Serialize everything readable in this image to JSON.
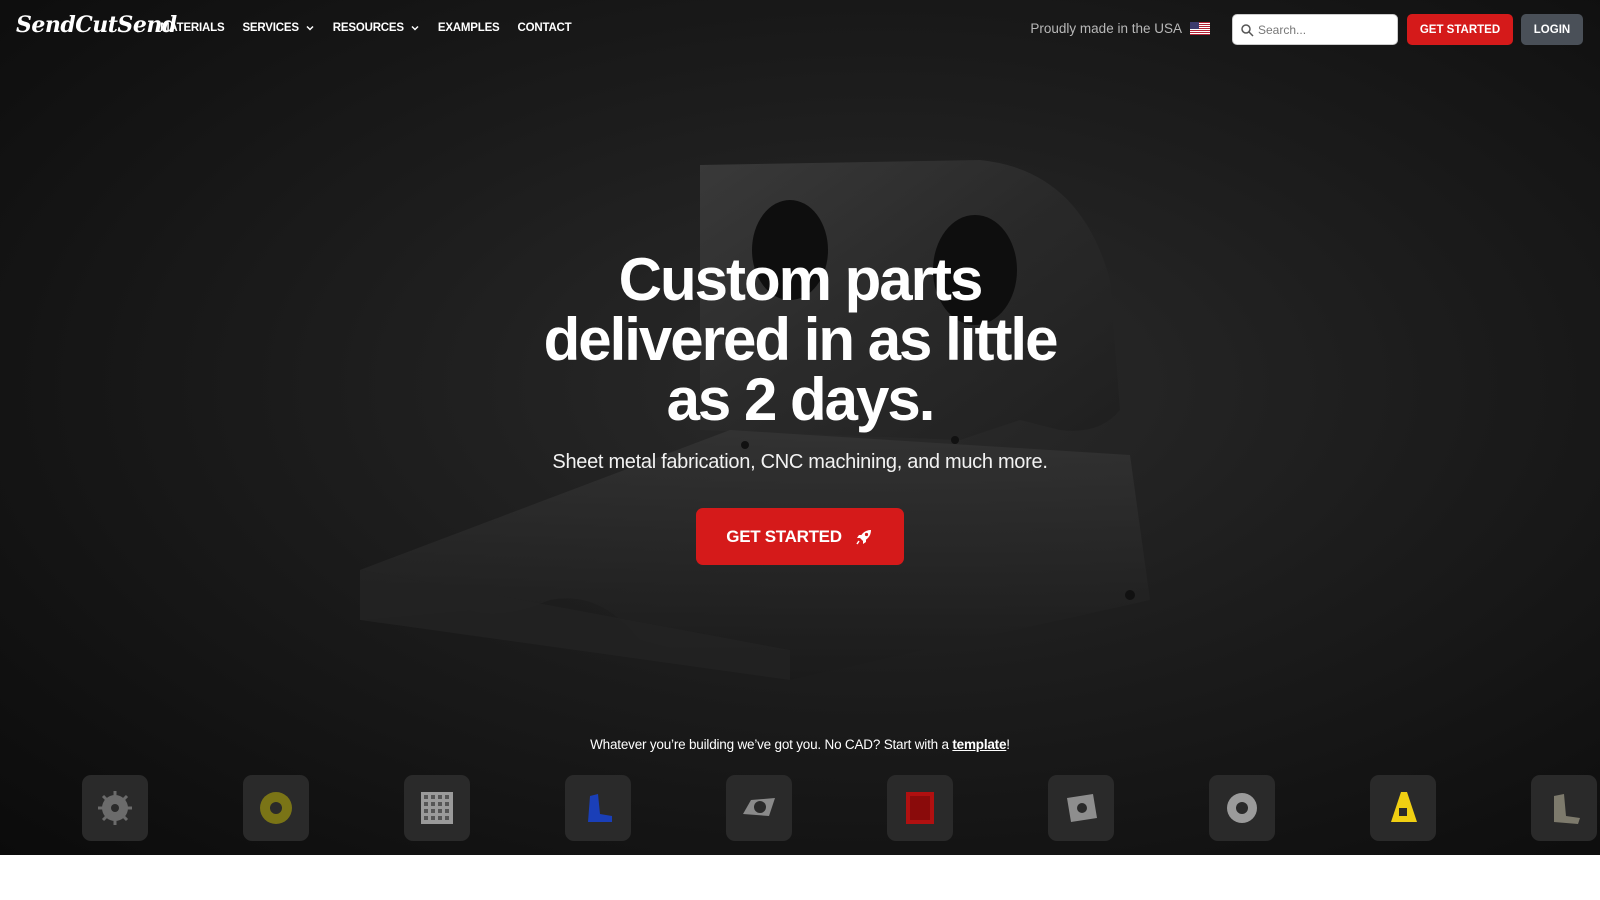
{
  "brand": {
    "logo_text": "SendCutSend"
  },
  "nav": {
    "items": [
      {
        "label": "MATERIALS",
        "has_dropdown": false
      },
      {
        "label": "SERVICES",
        "has_dropdown": true
      },
      {
        "label": "RESOURCES",
        "has_dropdown": true
      },
      {
        "label": "EXAMPLES",
        "has_dropdown": false
      },
      {
        "label": "CONTACT",
        "has_dropdown": false
      }
    ],
    "made_in": "Proudly made in the USA",
    "flag_icon": "us-flag-icon",
    "search_placeholder": "Search...",
    "get_started_label": "GET STARTED",
    "login_label": "LOGIN"
  },
  "hero": {
    "headline_lines": [
      "Custom parts",
      "delivered in as little",
      "as 2 days."
    ],
    "subhead": "Sheet metal fabrication, CNC machining, and much more.",
    "cta_label": "GET STARTED",
    "cta_icon": "rocket-icon"
  },
  "templates": {
    "prefix": "Whatever you’re building we’ve got you. No CAD? Start with a ",
    "link": "template",
    "suffix": "!",
    "tiles": [
      {
        "name": "gear-part-icon"
      },
      {
        "name": "donut-part-icon"
      },
      {
        "name": "perforated-plate-icon"
      },
      {
        "name": "blue-bracket-icon"
      },
      {
        "name": "flange-part-icon"
      },
      {
        "name": "red-box-part-icon"
      },
      {
        "name": "mount-plate-icon"
      },
      {
        "name": "ring-part-icon"
      },
      {
        "name": "yellow-bracket-icon"
      },
      {
        "name": "angle-bracket-icon"
      }
    ]
  },
  "colors": {
    "accent_red": "#d51a1a",
    "login_gray": "#4a5058",
    "background": "#161616"
  }
}
